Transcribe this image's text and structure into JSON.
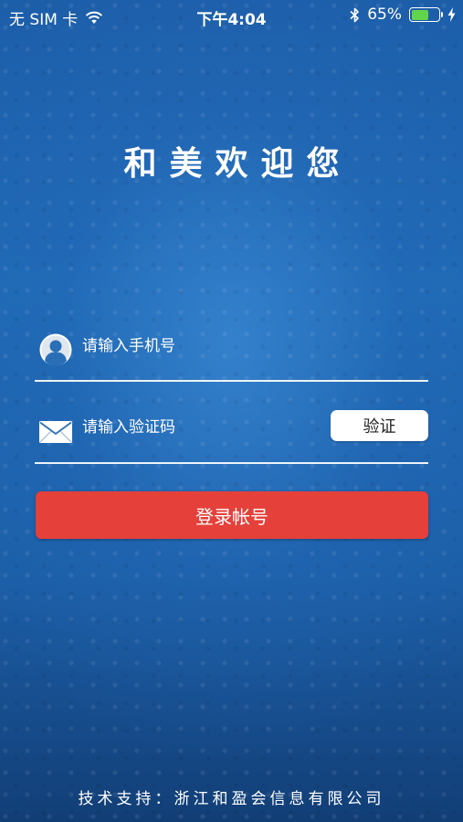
{
  "status_bar": {
    "carrier": "无 SIM 卡",
    "time": "下午4:04",
    "battery_percent": "65%",
    "battery_level": 0.65,
    "icons": [
      "wifi-icon",
      "bluetooth-icon",
      "battery-icon",
      "charging-icon"
    ]
  },
  "title": "和美欢迎您",
  "form": {
    "phone": {
      "icon": "user-avatar-icon",
      "placeholder": "请输入手机号",
      "value": ""
    },
    "code": {
      "icon": "envelope-icon",
      "placeholder": "请输入验证码",
      "value": "",
      "verify_label": "验证"
    },
    "login_label": "登录帐号"
  },
  "footer": {
    "support_text": "技术支持：浙江和盈会信息有限公司"
  },
  "colors": {
    "background": "#1f69b5",
    "login_button": "#e5403a",
    "battery_fill": "#62d44a"
  }
}
